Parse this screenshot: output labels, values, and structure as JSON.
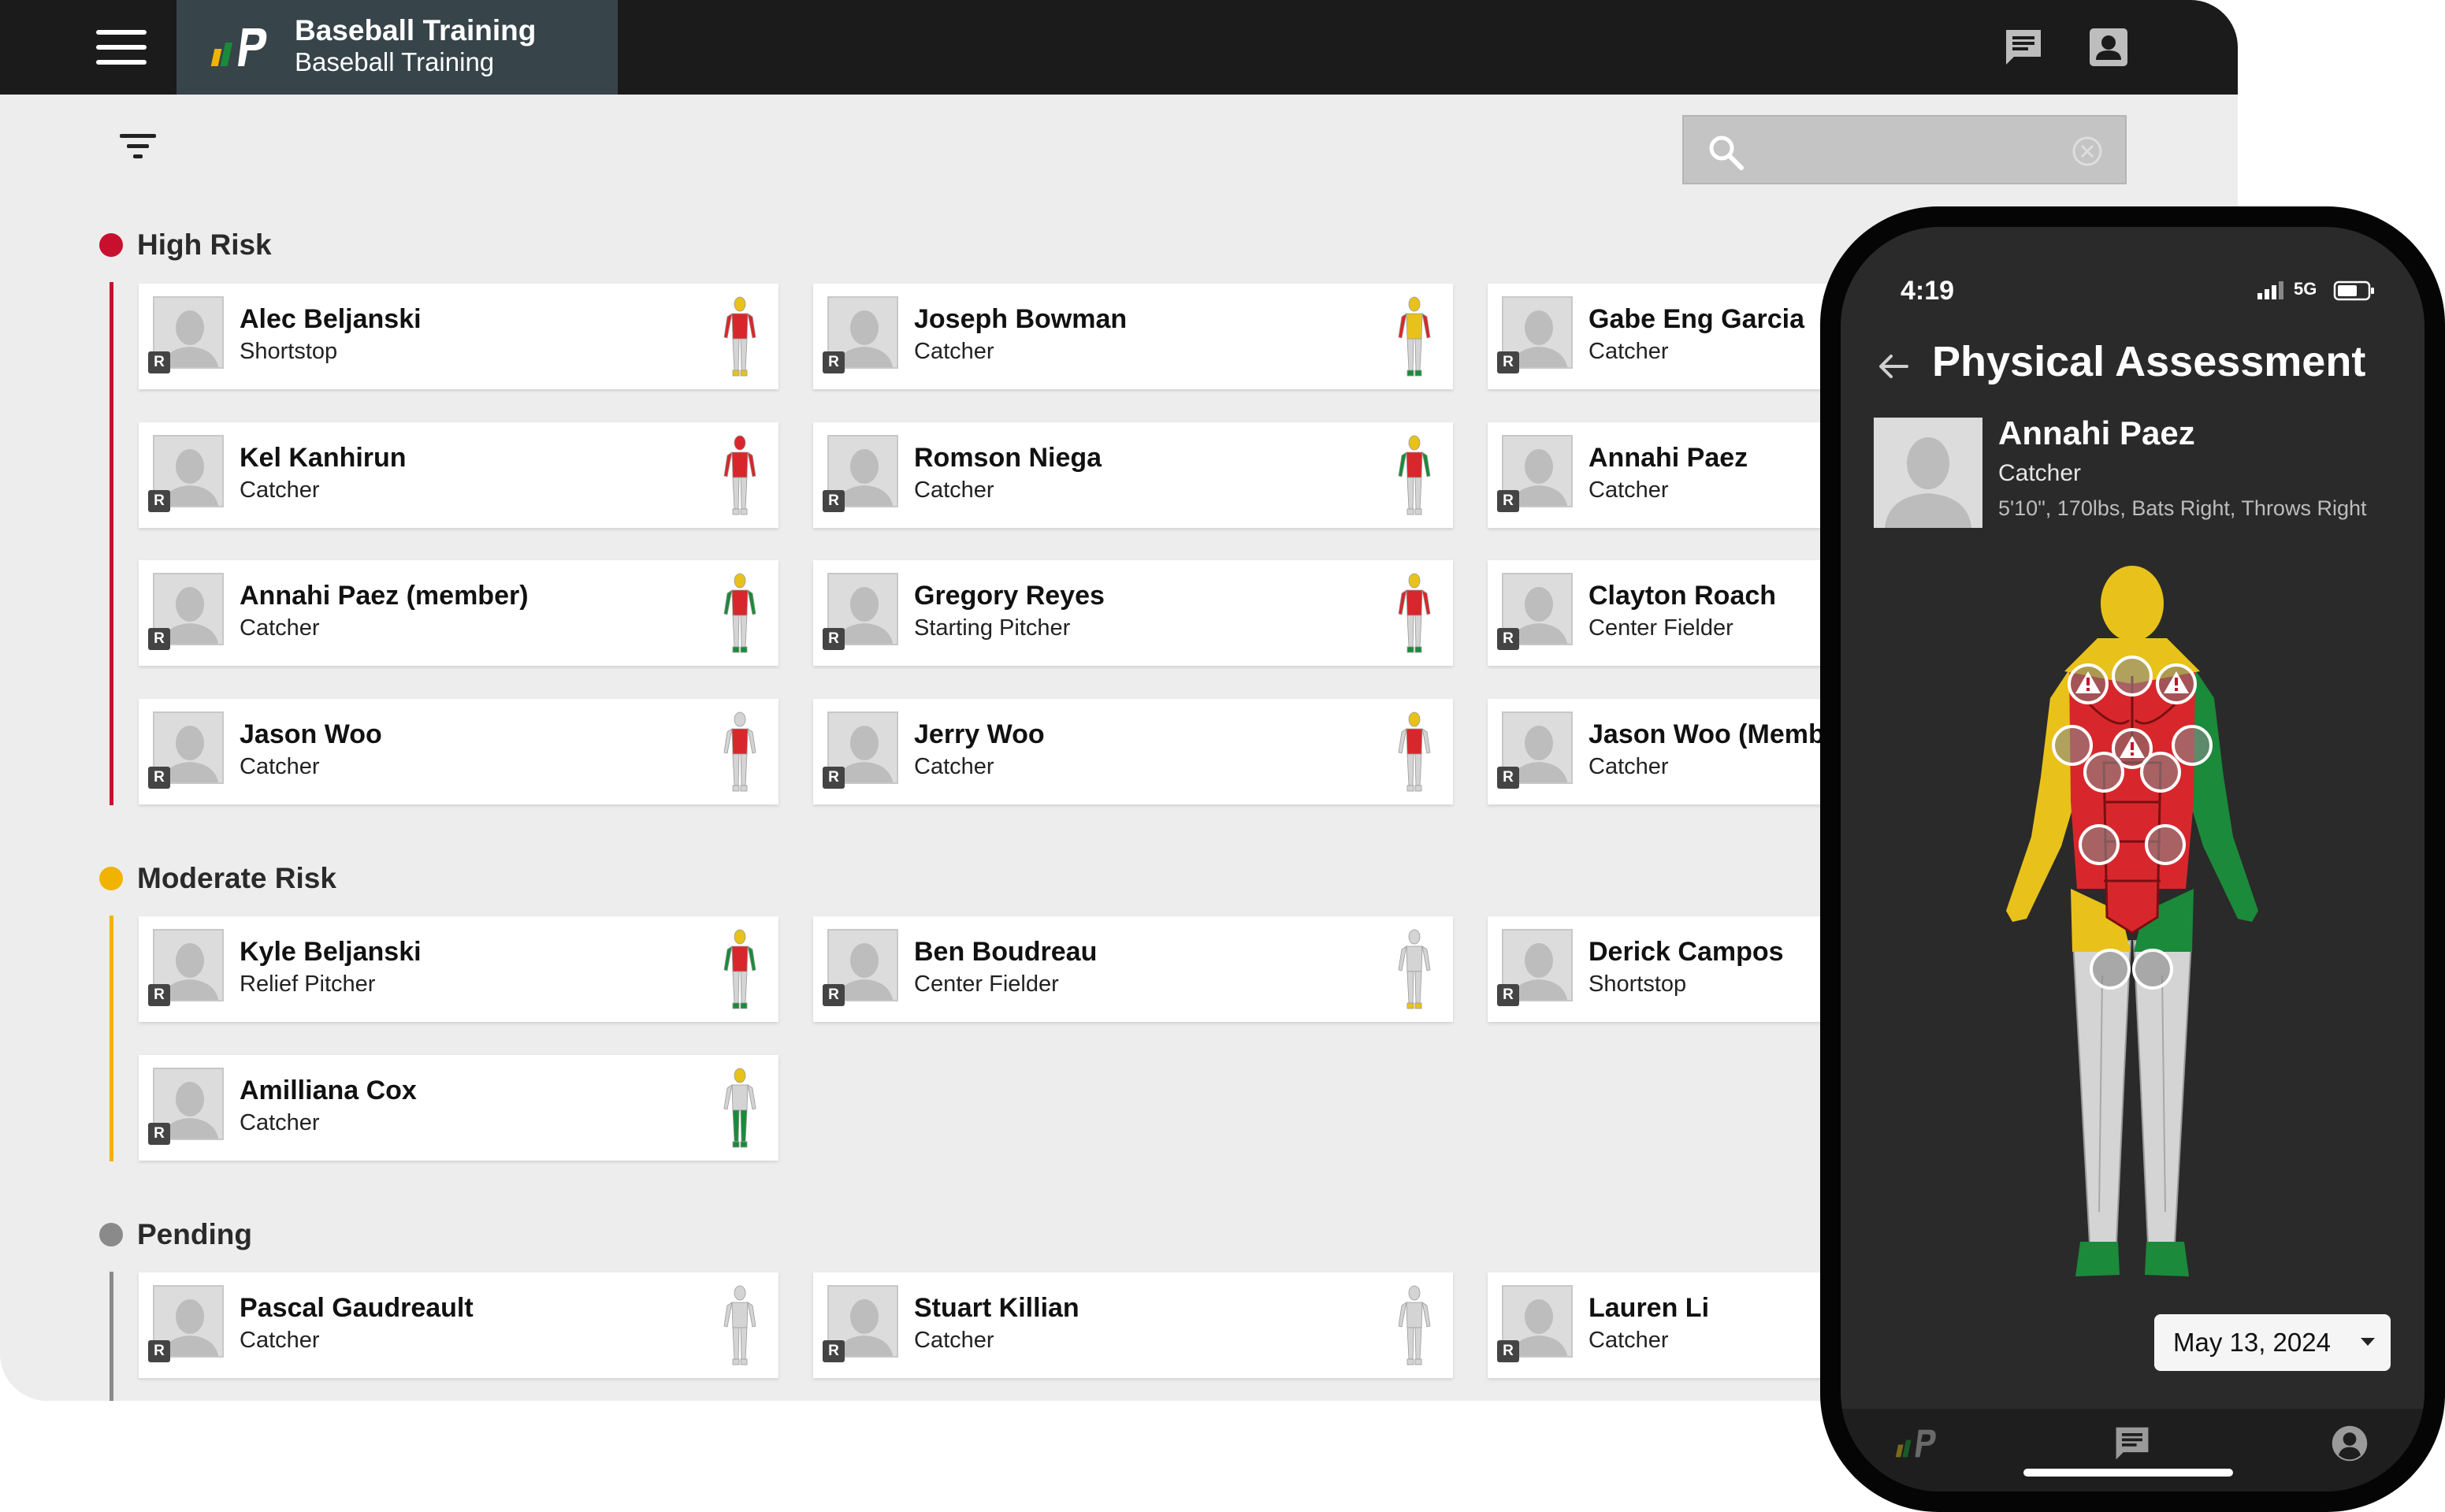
{
  "app": {
    "title": "Baseball Training",
    "subtitle": "Baseball Training"
  },
  "search": {
    "value": "",
    "placeholder": ""
  },
  "colors": {
    "high": "#c8102e",
    "moderate": "#f0b400",
    "pending": "#8a8a8a",
    "red": "#d8272c",
    "yellow": "#e8c21a",
    "green": "#1b8a3a",
    "gray": "#d4d4d4"
  },
  "sections": {
    "high": {
      "title": "High Risk"
    },
    "moderate": {
      "title": "Moderate Risk"
    },
    "pending": {
      "title": "Pending"
    }
  },
  "badge": "R",
  "players": [
    {
      "name": "Alec Beljanski",
      "position": "Shortstop",
      "head": "yellow",
      "torso": "red",
      "arms": "red",
      "legs": "gray",
      "feet": "yellow"
    },
    {
      "name": "Joseph Bowman",
      "position": "Catcher",
      "head": "yellow",
      "torso": "yellow",
      "arms": "red",
      "legs": "gray",
      "feet": "green"
    },
    {
      "name": "Gabe Eng Garcia",
      "position": "Catcher",
      "head": "yellow",
      "torso": "red",
      "arms": "red",
      "legs": "gray",
      "feet": "gray"
    },
    {
      "name": "Kel Kanhirun",
      "position": "Catcher",
      "head": "red",
      "torso": "red",
      "arms": "red",
      "legs": "gray",
      "feet": "gray"
    },
    {
      "name": "Romson Niega",
      "position": "Catcher",
      "head": "yellow",
      "torso": "red",
      "arms": "green",
      "legs": "gray",
      "feet": "gray"
    },
    {
      "name": "Annahi Paez",
      "position": "Catcher",
      "head": "yellow",
      "torso": "red",
      "arms": "yellow",
      "legs": "gray",
      "feet": "green"
    },
    {
      "name": "Annahi Paez (member)",
      "position": "Catcher",
      "head": "yellow",
      "torso": "red",
      "arms": "green",
      "legs": "gray",
      "feet": "green"
    },
    {
      "name": "Gregory Reyes",
      "position": "Starting Pitcher",
      "head": "yellow",
      "torso": "red",
      "arms": "red",
      "legs": "gray",
      "feet": "green"
    },
    {
      "name": "Clayton Roach",
      "position": "Center Fielder",
      "head": "yellow",
      "torso": "red",
      "arms": "red",
      "legs": "gray",
      "feet": "gray"
    },
    {
      "name": "Jason Woo",
      "position": "Catcher",
      "head": "gray",
      "torso": "red",
      "arms": "gray",
      "legs": "gray",
      "feet": "gray"
    },
    {
      "name": "Jerry Woo",
      "position": "Catcher",
      "head": "yellow",
      "torso": "red",
      "arms": "gray",
      "legs": "gray",
      "feet": "gray"
    },
    {
      "name": "Jason Woo (Member)",
      "position": "Catcher",
      "head": "gray",
      "torso": "red",
      "arms": "gray",
      "legs": "gray",
      "feet": "gray"
    },
    {
      "name": "Kyle Beljanski",
      "position": "Relief Pitcher",
      "head": "yellow",
      "torso": "red",
      "arms": "green",
      "legs": "gray",
      "feet": "green"
    },
    {
      "name": "Ben Boudreau",
      "position": "Center Fielder",
      "head": "gray",
      "torso": "gray",
      "arms": "gray",
      "legs": "gray",
      "feet": "yellow"
    },
    {
      "name": "Derick Campos",
      "position": "Shortstop",
      "head": "gray",
      "torso": "gray",
      "arms": "gray",
      "legs": "gray",
      "feet": "gray"
    },
    {
      "name": "Amilliana Cox",
      "position": "Catcher",
      "head": "yellow",
      "torso": "gray",
      "arms": "gray",
      "legs": "green",
      "feet": "green"
    },
    {
      "name": "Pascal Gaudreault",
      "position": "Catcher",
      "head": "gray",
      "torso": "gray",
      "arms": "gray",
      "legs": "gray",
      "feet": "gray"
    },
    {
      "name": "Stuart Killian",
      "position": "Catcher",
      "head": "gray",
      "torso": "gray",
      "arms": "gray",
      "legs": "gray",
      "feet": "gray"
    },
    {
      "name": "Lauren Li",
      "position": "Catcher",
      "head": "gray",
      "torso": "gray",
      "arms": "gray",
      "legs": "gray",
      "feet": "gray"
    }
  ],
  "phone": {
    "time": "4:19",
    "network": "5G",
    "title": "Physical Assessment",
    "athlete": {
      "name": "Annahi Paez",
      "position": "Catcher",
      "stats": "5'10\", 170lbs, Bats Right, Throws Right"
    },
    "body_map": {
      "head": "yellow",
      "trapezius": "yellow",
      "chest": "red",
      "abs": "red",
      "left_arm": "yellow",
      "right_arm": "green",
      "left_hip": "yellow",
      "right_hip": "green",
      "legs": "gray",
      "feet": "green"
    },
    "date": "May 13, 2024"
  }
}
